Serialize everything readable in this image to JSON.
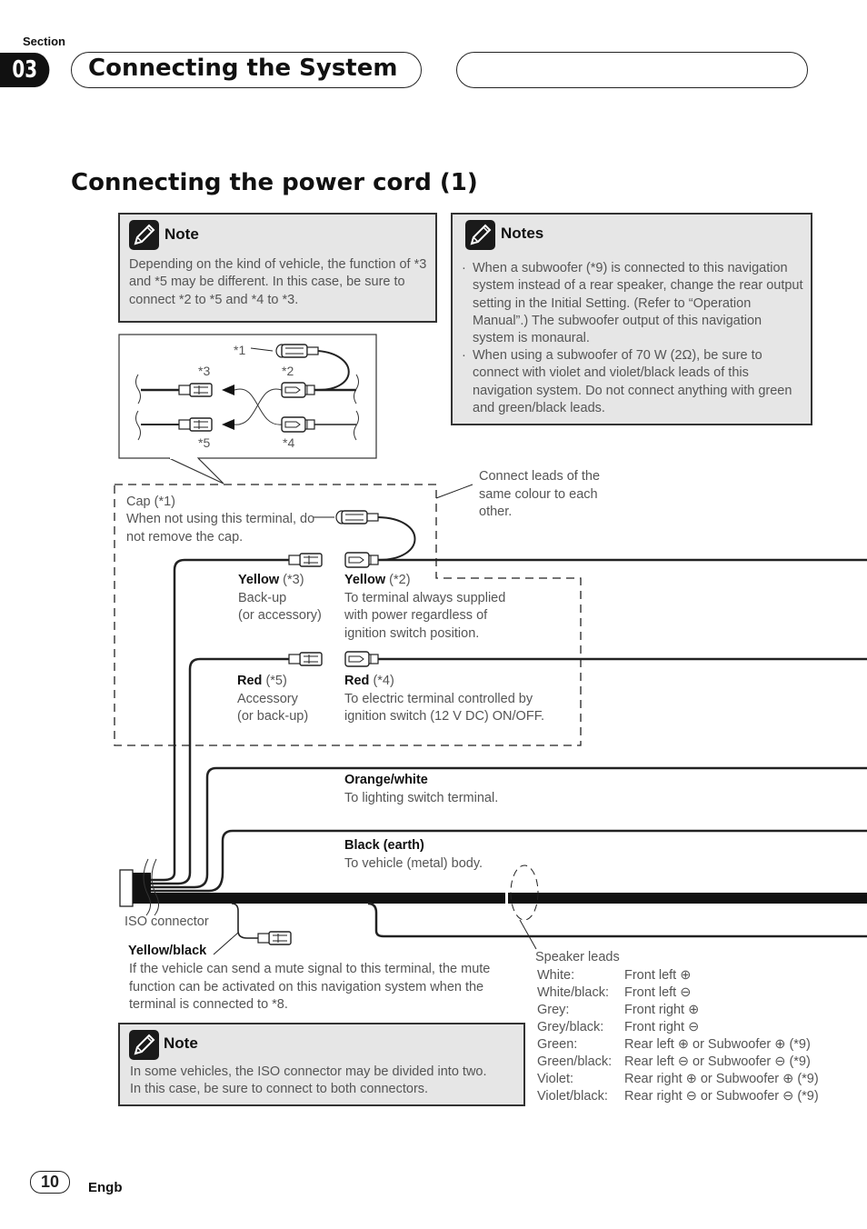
{
  "header": {
    "section_label": "Section",
    "section_number": "03",
    "section_title": "Connecting the System"
  },
  "page_heading": "Connecting the power cord (1)",
  "note_top_left": {
    "icon": "pencil-note-icon",
    "title": "Note",
    "text": "Depending on the kind of vehicle, the function of *3 and *5 may be different. In this case, be sure to connect *2 to *5 and *4 to *3."
  },
  "notes_top_right": {
    "icon": "pencil-note-icon",
    "title": "Notes",
    "items": [
      "When a subwoofer (*9) is connected to this navigation system instead of a rear speaker, change the rear output setting in the Initial Setting. (Refer to “Operation Manual”.) The subwoofer output of this navigation system is monaural.",
      "When using a subwoofer of 70 W (2Ω), be sure to connect with violet and violet/black leads of this navigation system. Do not connect anything with green and green/black leads."
    ]
  },
  "inset_diagram": {
    "labels": [
      "*1",
      "*2",
      "*3",
      "*4",
      "*5"
    ]
  },
  "callouts": {
    "connect_same_colour": "Connect leads of the same colour to each other.",
    "cap_title": "Cap (*1)",
    "cap_text": "When not using this terminal, do not remove the cap."
  },
  "leads": {
    "yellow3": {
      "color": "Yellow",
      "ref": "(*3)",
      "line1": "Back-up",
      "line2": "(or accessory)"
    },
    "yellow2": {
      "color": "Yellow",
      "ref": "(*2)",
      "line1": "To terminal always supplied",
      "line2": "with power regardless of",
      "line3": "ignition switch position."
    },
    "red5": {
      "color": "Red",
      "ref": "(*5)",
      "line1": "Accessory",
      "line2": "(or back-up)"
    },
    "red4": {
      "color": "Red",
      "ref": "(*4)",
      "line1": "To electric terminal controlled by",
      "line2": "ignition switch (12 V DC) ON/OFF."
    },
    "orange_white": {
      "title": "Orange/white",
      "text": "To lighting switch terminal."
    },
    "black_earth": {
      "title": "Black (earth)",
      "text": "To vehicle (metal) body."
    },
    "iso_connector": "ISO connector",
    "yellow_black": {
      "title": "Yellow/black",
      "text": "If the vehicle can send a mute signal to this terminal, the mute function can be activated on this navigation system when the terminal is connected to *8."
    }
  },
  "note_bottom": {
    "icon": "pencil-note-icon",
    "title": "Note",
    "text1": "In some vehicles, the ISO connector may be divided into two.",
    "text2": "In this case, be sure to connect to both connectors."
  },
  "speaker_leads": {
    "title": "Speaker leads",
    "rows": [
      {
        "color": "White:",
        "desc": "Front left ⊕"
      },
      {
        "color": "White/black:",
        "desc": "Front left ⊖"
      },
      {
        "color": "Grey:",
        "desc": "Front right ⊕"
      },
      {
        "color": "Grey/black:",
        "desc": "Front right ⊖"
      },
      {
        "color": "Green:",
        "desc": "Rear left ⊕ or Subwoofer ⊕ (*9)"
      },
      {
        "color": "Green/black:",
        "desc": "Rear left ⊖ or Subwoofer ⊖ (*9)"
      },
      {
        "color": "Violet:",
        "desc": "Rear right ⊕ or Subwoofer ⊕ (*9)"
      },
      {
        "color": "Violet/black:",
        "desc": "Rear right ⊖ or Subwoofer ⊖ (*9)"
      }
    ]
  },
  "footer": {
    "page_number": "10",
    "language": "Engb"
  }
}
